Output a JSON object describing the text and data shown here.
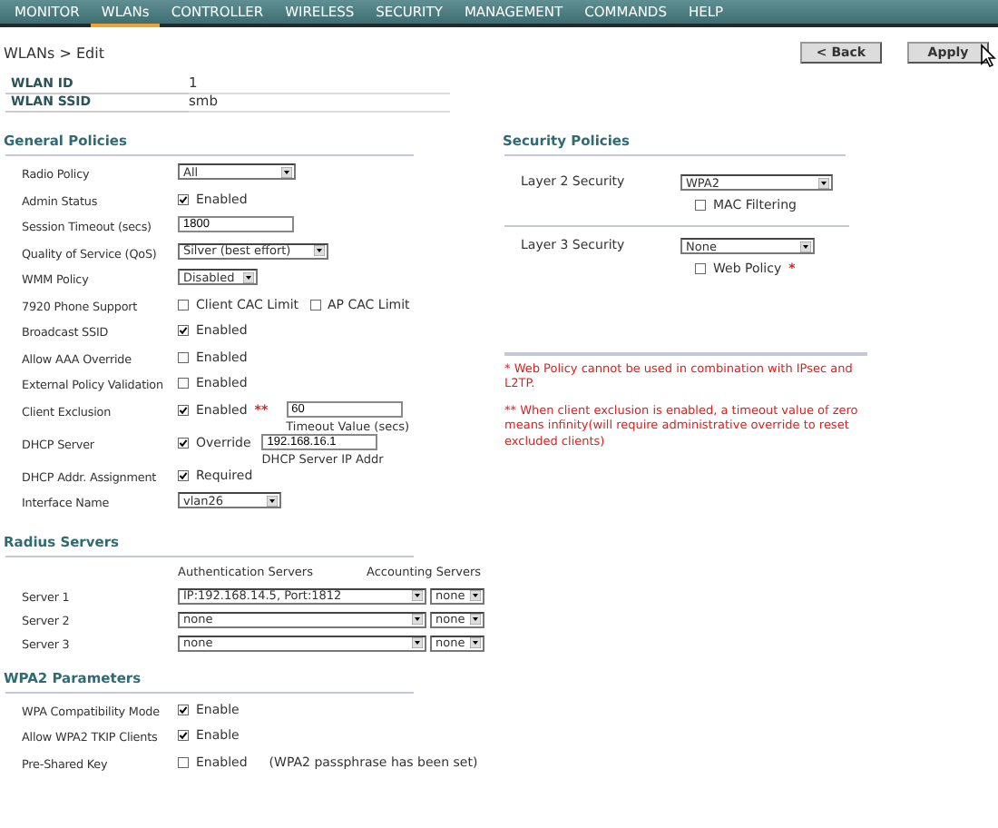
{
  "nav": [
    {
      "label": "MONITOR",
      "selected": false
    },
    {
      "label": "WLANs",
      "selected": true
    },
    {
      "label": "CONTROLLER",
      "selected": false
    },
    {
      "label": "WIRELESS",
      "selected": false
    },
    {
      "label": "SECURITY",
      "selected": false
    },
    {
      "label": "MANAGEMENT",
      "selected": false
    },
    {
      "label": "COMMANDS",
      "selected": false
    },
    {
      "label": "HELP",
      "selected": false
    }
  ],
  "breadcrumb": "WLANs > Edit",
  "buttons": [
    {
      "label": "< Back"
    },
    {
      "label": "Apply"
    }
  ],
  "wlan_fields": [
    {
      "label": "WLAN ID",
      "value": "1"
    },
    {
      "label": "WLAN SSID",
      "value": "smb"
    }
  ],
  "general_policies": {
    "title": "General Policies",
    "rows": [
      {
        "label": "Radio Policy",
        "controls": [
          {
            "kind": "select",
            "value": "All"
          }
        ]
      },
      {
        "label": "Admin Status",
        "controls": [
          {
            "kind": "checkbox",
            "checked": true,
            "label": "Enabled"
          }
        ]
      },
      {
        "label": "Session Timeout (secs)",
        "controls": [
          {
            "kind": "input",
            "value": "1800"
          }
        ]
      },
      {
        "label": "Quality of Service (QoS)",
        "controls": [
          {
            "kind": "select",
            "value": "Silver (best effort)"
          }
        ]
      },
      {
        "label": "WMM Policy",
        "controls": [
          {
            "kind": "select",
            "value": "Disabled"
          }
        ]
      },
      {
        "label": "7920 Phone Support",
        "controls": [
          {
            "kind": "checkbox",
            "checked": false,
            "label": "Client CAC Limit"
          },
          {
            "kind": "checkbox",
            "checked": false,
            "label": "AP CAC Limit"
          }
        ]
      },
      {
        "label": "Broadcast SSID",
        "controls": [
          {
            "kind": "checkbox",
            "checked": true,
            "label": "Enabled"
          }
        ]
      },
      {
        "label": "Allow AAA Override",
        "controls": [
          {
            "kind": "checkbox",
            "checked": false,
            "label": "Enabled"
          }
        ]
      },
      {
        "label": "External Policy Validation",
        "controls": [
          {
            "kind": "checkbox",
            "checked": false,
            "label": "Enabled"
          }
        ]
      },
      {
        "label": "Client Exclusion",
        "controls": [
          {
            "kind": "checkbox",
            "checked": true,
            "label": "Enabled",
            "marker": "**"
          },
          {
            "kind": "input",
            "value": "60",
            "caption": "Timeout Value (secs)"
          }
        ]
      },
      {
        "label": "DHCP Server",
        "controls": [
          {
            "kind": "checkbox",
            "checked": true,
            "label": "Override"
          },
          {
            "kind": "input",
            "value": "192.168.16.1",
            "caption": "DHCP Server IP Addr"
          }
        ]
      },
      {
        "label": "DHCP Addr. Assignment",
        "controls": [
          {
            "kind": "checkbox",
            "checked": true,
            "label": "Required"
          }
        ]
      },
      {
        "label": "Interface Name",
        "controls": [
          {
            "kind": "select",
            "value": "vlan26"
          }
        ]
      }
    ]
  },
  "security_policies": {
    "title": "Security Policies",
    "groups": [
      {
        "label": "Layer 2 Security",
        "select": "WPA2",
        "options": [
          {
            "kind": "checkbox",
            "checked": false,
            "label": "MAC Filtering"
          }
        ]
      },
      {
        "label": "Layer 3 Security",
        "select": "None",
        "options": [
          {
            "kind": "checkbox",
            "checked": false,
            "label": "Web Policy",
            "marker": "*"
          }
        ]
      }
    ],
    "notes": [
      "* Web Policy cannot be used in combination with IPsec and L2TP.",
      "** When client exclusion is enabled, a timeout value of zero means infinity(will require administrative override to reset excluded clients)"
    ]
  },
  "radius_servers": {
    "title": "Radius Servers",
    "columns": [
      "Authentication Servers",
      "Accounting Servers"
    ],
    "rows": [
      {
        "label": "Server 1",
        "authentication": "IP:192.168.14.5, Port:1812",
        "accounting": "none"
      },
      {
        "label": "Server 2",
        "authentication": "none",
        "accounting": "none"
      },
      {
        "label": "Server 3",
        "authentication": "none",
        "accounting": "none"
      }
    ]
  },
  "wpa2_parameters": {
    "title": "WPA2 Parameters",
    "rows": [
      {
        "label": "WPA Compatibility Mode",
        "controls": [
          {
            "kind": "checkbox",
            "checked": true,
            "label": "Enable"
          }
        ]
      },
      {
        "label": "Allow WPA2 TKIP Clients",
        "controls": [
          {
            "kind": "checkbox",
            "checked": true,
            "label": "Enable"
          }
        ]
      },
      {
        "label": "Pre-Shared Key",
        "controls": [
          {
            "kind": "checkbox",
            "checked": false,
            "label": "Enabled",
            "note": "(WPA2 passphrase has been set)"
          }
        ]
      }
    ]
  }
}
